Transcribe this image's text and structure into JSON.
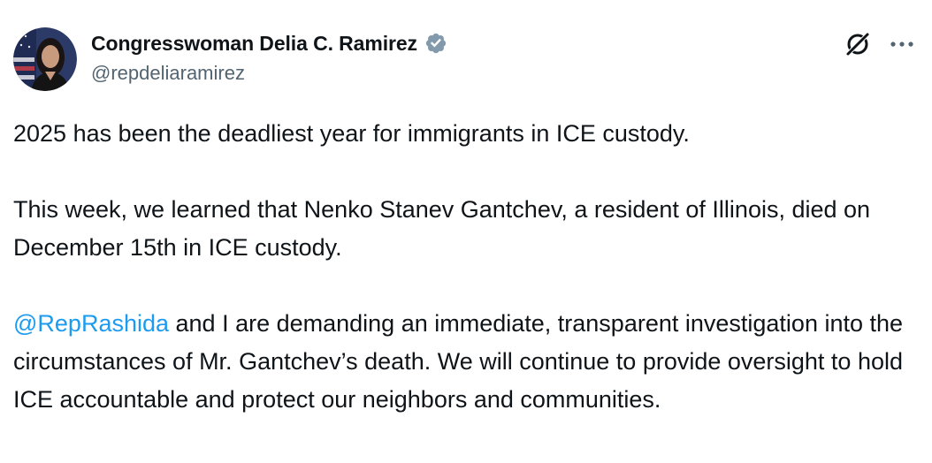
{
  "author": {
    "display_name": "Congresswoman Delia C. Ramirez",
    "handle": "@repdeliaramirez",
    "verified_badge_color": "#829aab"
  },
  "icons": {
    "verified": "verified-badge-icon",
    "grok": "grok-icon",
    "more": "more-options-icon"
  },
  "tweet": {
    "paragraph_1": "2025 has been the deadliest year for immigrants in ICE custody.",
    "paragraph_2": "This week, we learned that Nenko Stanev Gantchev, a resident of Illinois, died on December 15th in ICE custody.",
    "mention": "@RepRashida",
    "paragraph_3_rest": " and I are demanding an immediate, transparent investigation into the circumstances of Mr. Gantchev’s death. We will continue to provide oversight to hold ICE accountable and protect our neighbors and communities."
  },
  "colors": {
    "text": "#0f1419",
    "secondary": "#536471",
    "link": "#1d9bf0"
  }
}
